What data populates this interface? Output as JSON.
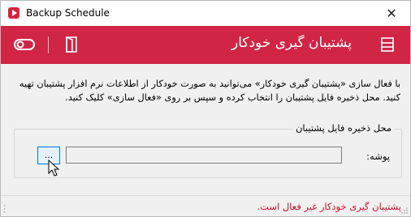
{
  "window": {
    "title": "Backup Schedule",
    "close_glyph": "✕"
  },
  "header": {
    "title": "پشتیبان گیری خودکار",
    "accent": "#d02545",
    "icons": [
      "menu-icon",
      "toggle-icon",
      "door-icon"
    ]
  },
  "description": "با فعال سازی «پشتیبان گیری خودکار» می‌توانید به صورت خودکار از اطلاعات نرم افزار پشتیبان تهیه کنید. محل ذخیره فایل پشتیبان را انتخاب کرده و سپس بر روی «فعال سازی» کلیک کنید.",
  "backup_location": {
    "legend": "محل ذخیره فایل پشتیبان",
    "folder_label": "پوشه:",
    "folder_value": "",
    "browse_label": "..."
  },
  "status": {
    "text": "پشتیبان گیری خودکار غیر فعال است.",
    "color": "#c8102e"
  }
}
